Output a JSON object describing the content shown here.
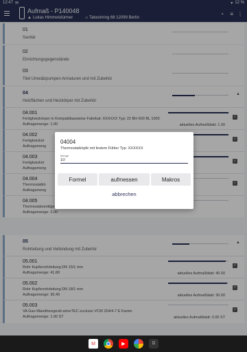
{
  "statusbar": {
    "time": "12:47",
    "battery": "12 %"
  },
  "appbar": {
    "title": "Aufmaß - P140048",
    "person": "Lukas Himmelstürmer",
    "address": "Tatooinring 68 12099 Berlin"
  },
  "sections": [
    {
      "num": "01",
      "name": "Sanitär",
      "progress": 0
    },
    {
      "num": "02",
      "name": "Einrichtungsgegenstände",
      "progress": 0
    },
    {
      "num": "03",
      "name": "Titel Umwälzpumpen Armaturen und mit Zubehör",
      "progress": 0
    },
    {
      "num": "04",
      "name": "Heizflächen und Heizkörper mit Zubehör",
      "progress": 0.4
    },
    {
      "num": "05",
      "name": "Rohrleitung und Verbindung mit Zubehör",
      "progress": 0.3
    }
  ],
  "items04": [
    {
      "num": "04.001",
      "name": "Fertigheizkörper in Kompaktbauweise Fabrikat: XXXXXX Typ: 22 BH 600 BL 1000",
      "qty": "Auftragsmenge: 1.00",
      "blatt": "aktuelles Aufmaßblatt: 1.00"
    },
    {
      "num": "04.002",
      "name": "Fertigheizkör",
      "qty": "Auftragsmeng",
      "blatt": ""
    },
    {
      "num": "04.003",
      "name": "Fertigheizkör",
      "qty": "Auftragsmeng",
      "blatt": ""
    },
    {
      "num": "04.004",
      "name": "Thermostatkö",
      "qty": "Auftragsmeng",
      "blatt": ""
    },
    {
      "num": "04.005",
      "name": "Thermostatventilgehäuse DN 15",
      "qty": "Auftragsmenge: 2.00",
      "blatt": ""
    }
  ],
  "items05": [
    {
      "num": "05.001",
      "name": "Rohr Kupferrohrleitung DN 15/1 mm",
      "qty": "Auftragsmenge: 41.80",
      "blatt": "aktuelles Aufmaßblatt: 40.00"
    },
    {
      "num": "05.002",
      "name": "Rohr Kupferrohrleitung DN 18/1 mm",
      "qty": "Auftragsmenge: 30.40",
      "blatt": "aktuelles Aufmaßblatt: 30.00"
    },
    {
      "num": "05.003",
      "name": "VA Gas-Wandheizgerät atmoTEC exclusiv VCW 254/4-7 E Kamin",
      "qty": "Auftragsmenge: 1.00 ST",
      "blatt": "aktuelles Aufmaßblatt: 0.00 ST"
    }
  ],
  "dialog": {
    "num": "04004",
    "desc": "Thermostatköpfe mit festem Fühler Typ: XXXXXX",
    "field_label": "Menge",
    "field_value": "10",
    "btn_formel": "Formel",
    "btn_aufmessen": "aufmessen",
    "btn_makros": "Makros",
    "cancel": "abbrechen"
  },
  "navbar": {
    "icons": [
      "gmail-icon",
      "chrome-icon",
      "youtube-icon",
      "photos-icon",
      "apps-icon"
    ]
  },
  "colors": {
    "primary": "#283055",
    "accent": "#8ea9c8"
  }
}
